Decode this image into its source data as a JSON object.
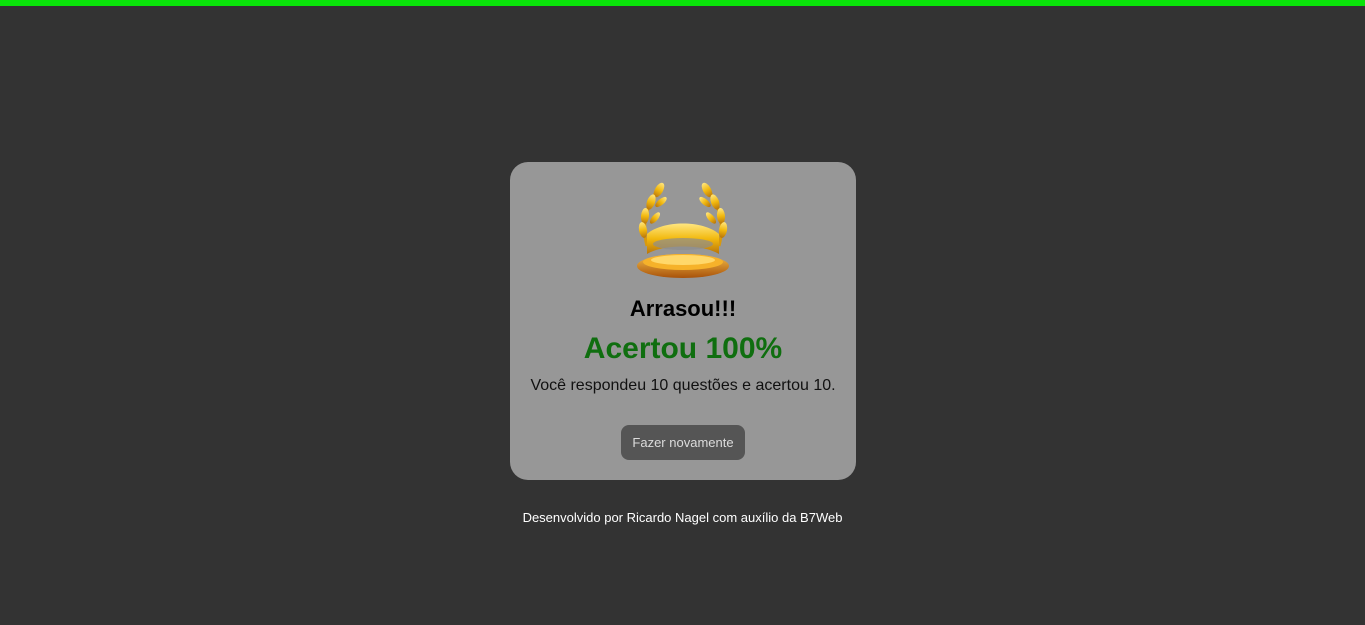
{
  "progress": {
    "percent": 100,
    "color": "#0ae30a"
  },
  "result": {
    "icon": "trophy-icon",
    "headline": "Arrasou!!!",
    "score": "Acertou 100%",
    "score_color": "#0f6e0f",
    "summary": "Você respondeu 10 questões e acertou 10.",
    "retry_label": "Fazer novamente"
  },
  "footer": {
    "text": "Desenvolvido por Ricardo Nagel com auxílio da B7Web"
  }
}
